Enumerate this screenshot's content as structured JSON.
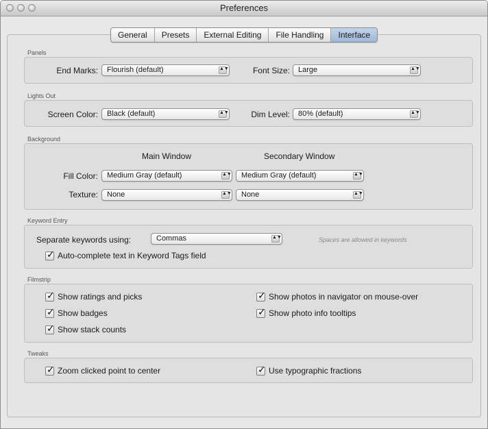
{
  "window": {
    "title": "Preferences"
  },
  "tabs": [
    {
      "label": "General",
      "active": false
    },
    {
      "label": "Presets",
      "active": false
    },
    {
      "label": "External Editing",
      "active": false
    },
    {
      "label": "File Handling",
      "active": false
    },
    {
      "label": "Interface",
      "active": true
    }
  ],
  "panels": {
    "title": "Panels",
    "end_marks_label": "End Marks:",
    "end_marks_value": "Flourish (default)",
    "font_size_label": "Font Size:",
    "font_size_value": "Large"
  },
  "lights_out": {
    "title": "Lights Out",
    "screen_color_label": "Screen Color:",
    "screen_color_value": "Black (default)",
    "dim_level_label": "Dim Level:",
    "dim_level_value": "80% (default)"
  },
  "background": {
    "title": "Background",
    "main_window_header": "Main Window",
    "secondary_window_header": "Secondary Window",
    "fill_color_label": "Fill Color:",
    "fill_main_value": "Medium Gray (default)",
    "fill_secondary_value": "Medium Gray (default)",
    "texture_label": "Texture:",
    "texture_main_value": "None",
    "texture_secondary_value": "None"
  },
  "keyword_entry": {
    "title": "Keyword Entry",
    "separate_label": "Separate keywords using:",
    "separate_value": "Commas",
    "hint": "Spaces are allowed in keywords",
    "autocomplete_label": "Auto-complete text in Keyword Tags field",
    "autocomplete_checked": true
  },
  "filmstrip": {
    "title": "Filmstrip",
    "ratings_label": "Show ratings and picks",
    "badges_label": "Show badges",
    "stack_label": "Show stack counts",
    "navigator_label": "Show photos in navigator on mouse-over",
    "tooltips_label": "Show photo info tooltips"
  },
  "tweaks": {
    "title": "Tweaks",
    "zoom_label": "Zoom clicked point to center",
    "fractions_label": "Use typographic fractions"
  },
  "glyphs": {
    "checkmark": "✓",
    "popup_arrows": "▲▼"
  }
}
